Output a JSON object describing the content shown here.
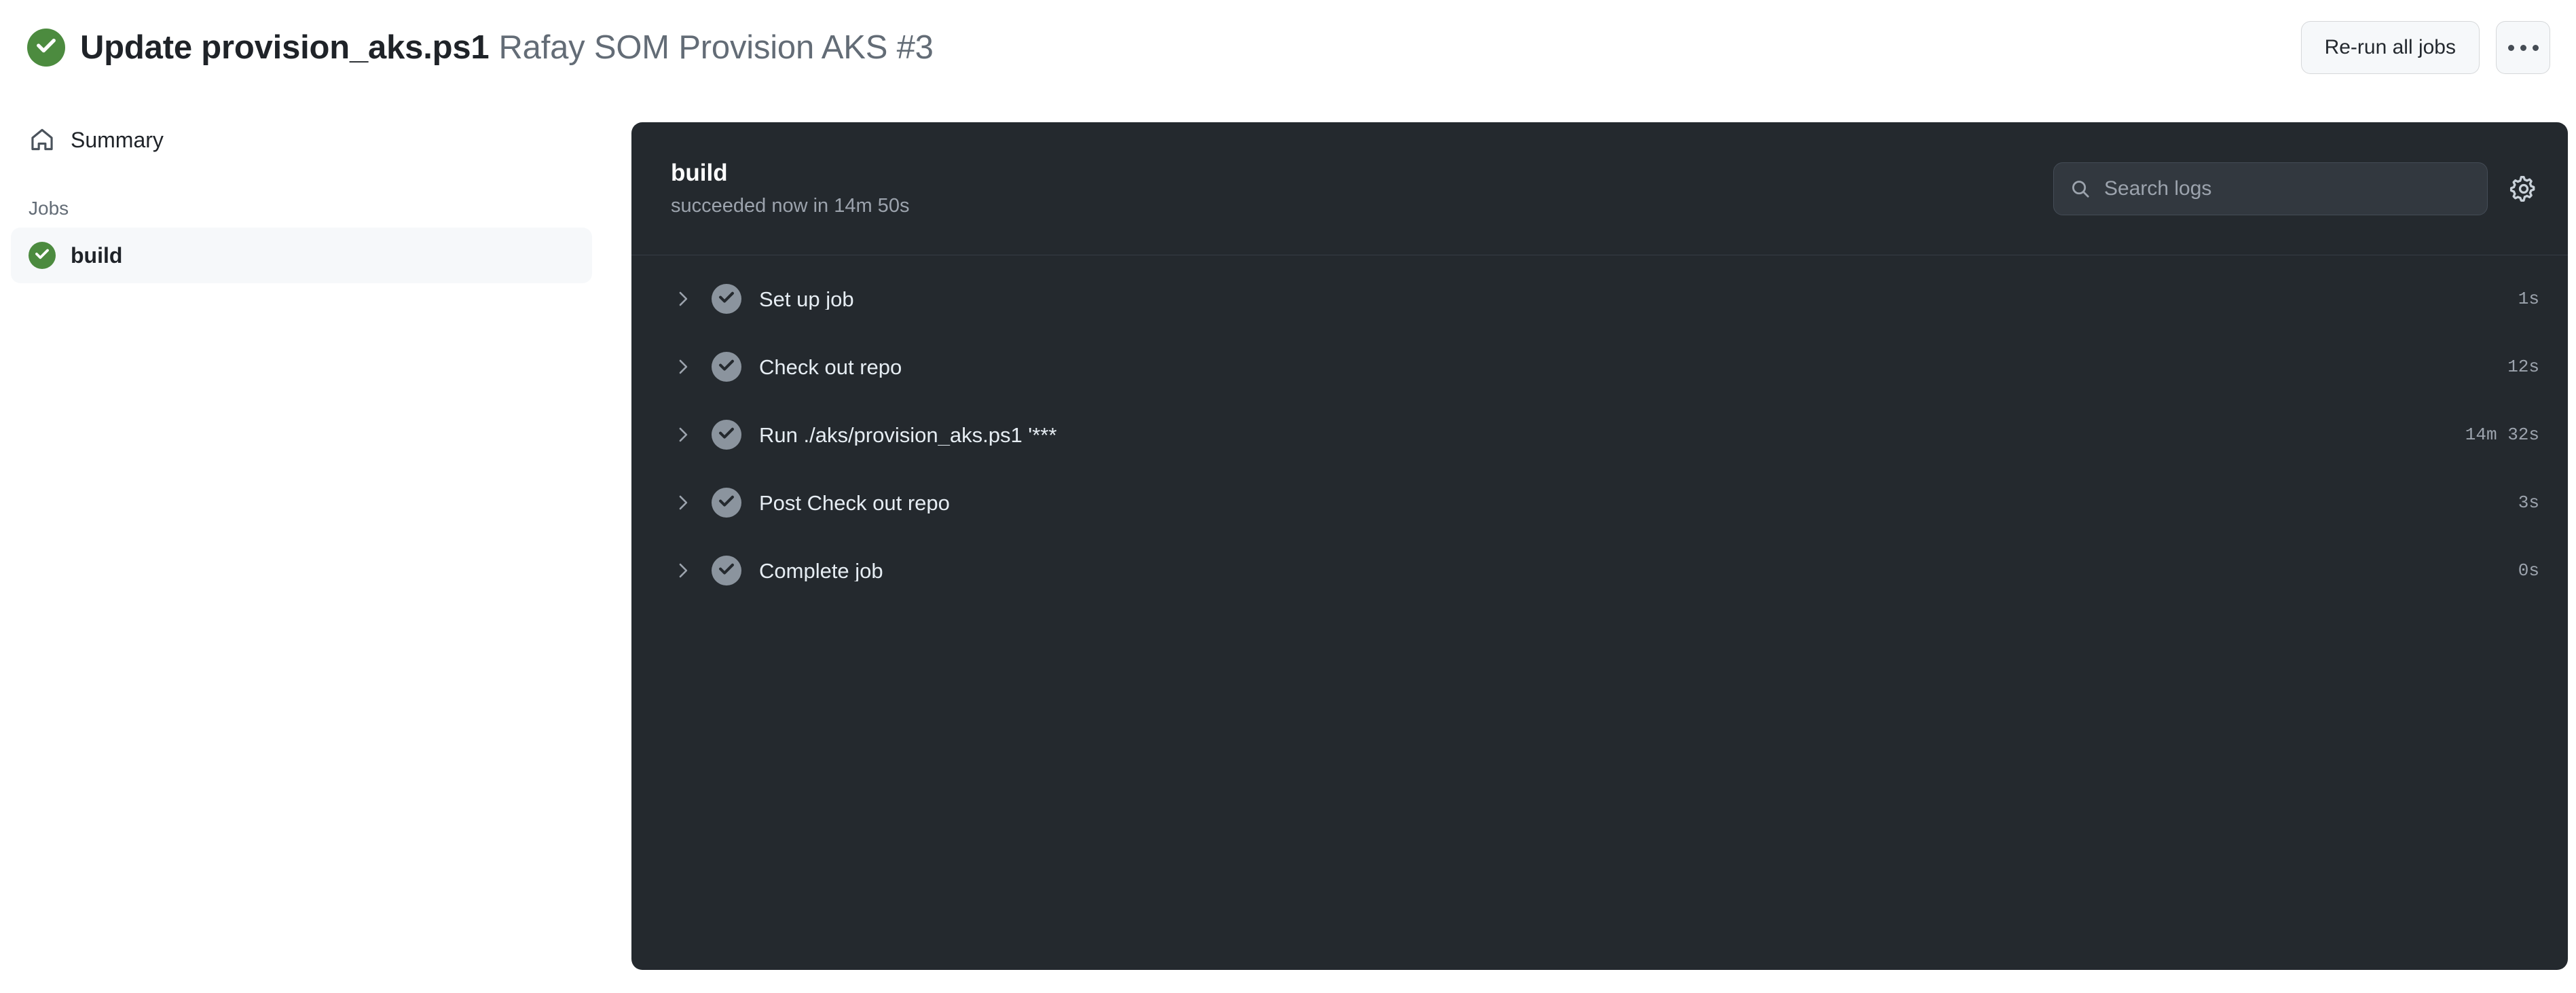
{
  "header": {
    "status_icon": "check-circle-success-icon",
    "status_color": "#4c8b3f",
    "title_main": "Update provision_aks.ps1",
    "title_sub": "Rafay SOM Provision AKS #3",
    "rerun_label": "Re-run all jobs",
    "kebab_icon": "kebab-horizontal-icon"
  },
  "sidebar": {
    "summary": {
      "icon": "home-icon",
      "label": "Summary"
    },
    "jobs_heading": "Jobs",
    "jobs": [
      {
        "icon": "check-circle-success-icon",
        "label": "build",
        "selected": true
      }
    ]
  },
  "log_panel": {
    "job_name": "build",
    "job_status": "succeeded now in 14m 50s",
    "search": {
      "icon": "search-icon",
      "value": "",
      "placeholder": "Search logs"
    },
    "settings_icon": "gear-icon",
    "steps": [
      {
        "expand_icon": "chevron-right-icon",
        "status_icon": "check-circle-icon",
        "label": "Set up job",
        "duration": "1s"
      },
      {
        "expand_icon": "chevron-right-icon",
        "status_icon": "check-circle-icon",
        "label": "Check out repo",
        "duration": "12s"
      },
      {
        "expand_icon": "chevron-right-icon",
        "status_icon": "check-circle-icon",
        "label": "Run ./aks/provision_aks.ps1 '***",
        "duration": "14m 32s"
      },
      {
        "expand_icon": "chevron-right-icon",
        "status_icon": "check-circle-icon",
        "label": "Post Check out repo",
        "duration": "3s"
      },
      {
        "expand_icon": "chevron-right-icon",
        "status_icon": "check-circle-icon",
        "label": "Complete job",
        "duration": "0s"
      }
    ]
  },
  "colors": {
    "success_green": "#4c8b3f",
    "panel_bg": "#24292e",
    "step_check_gray": "#8b949e",
    "text_muted": "#636c76"
  }
}
